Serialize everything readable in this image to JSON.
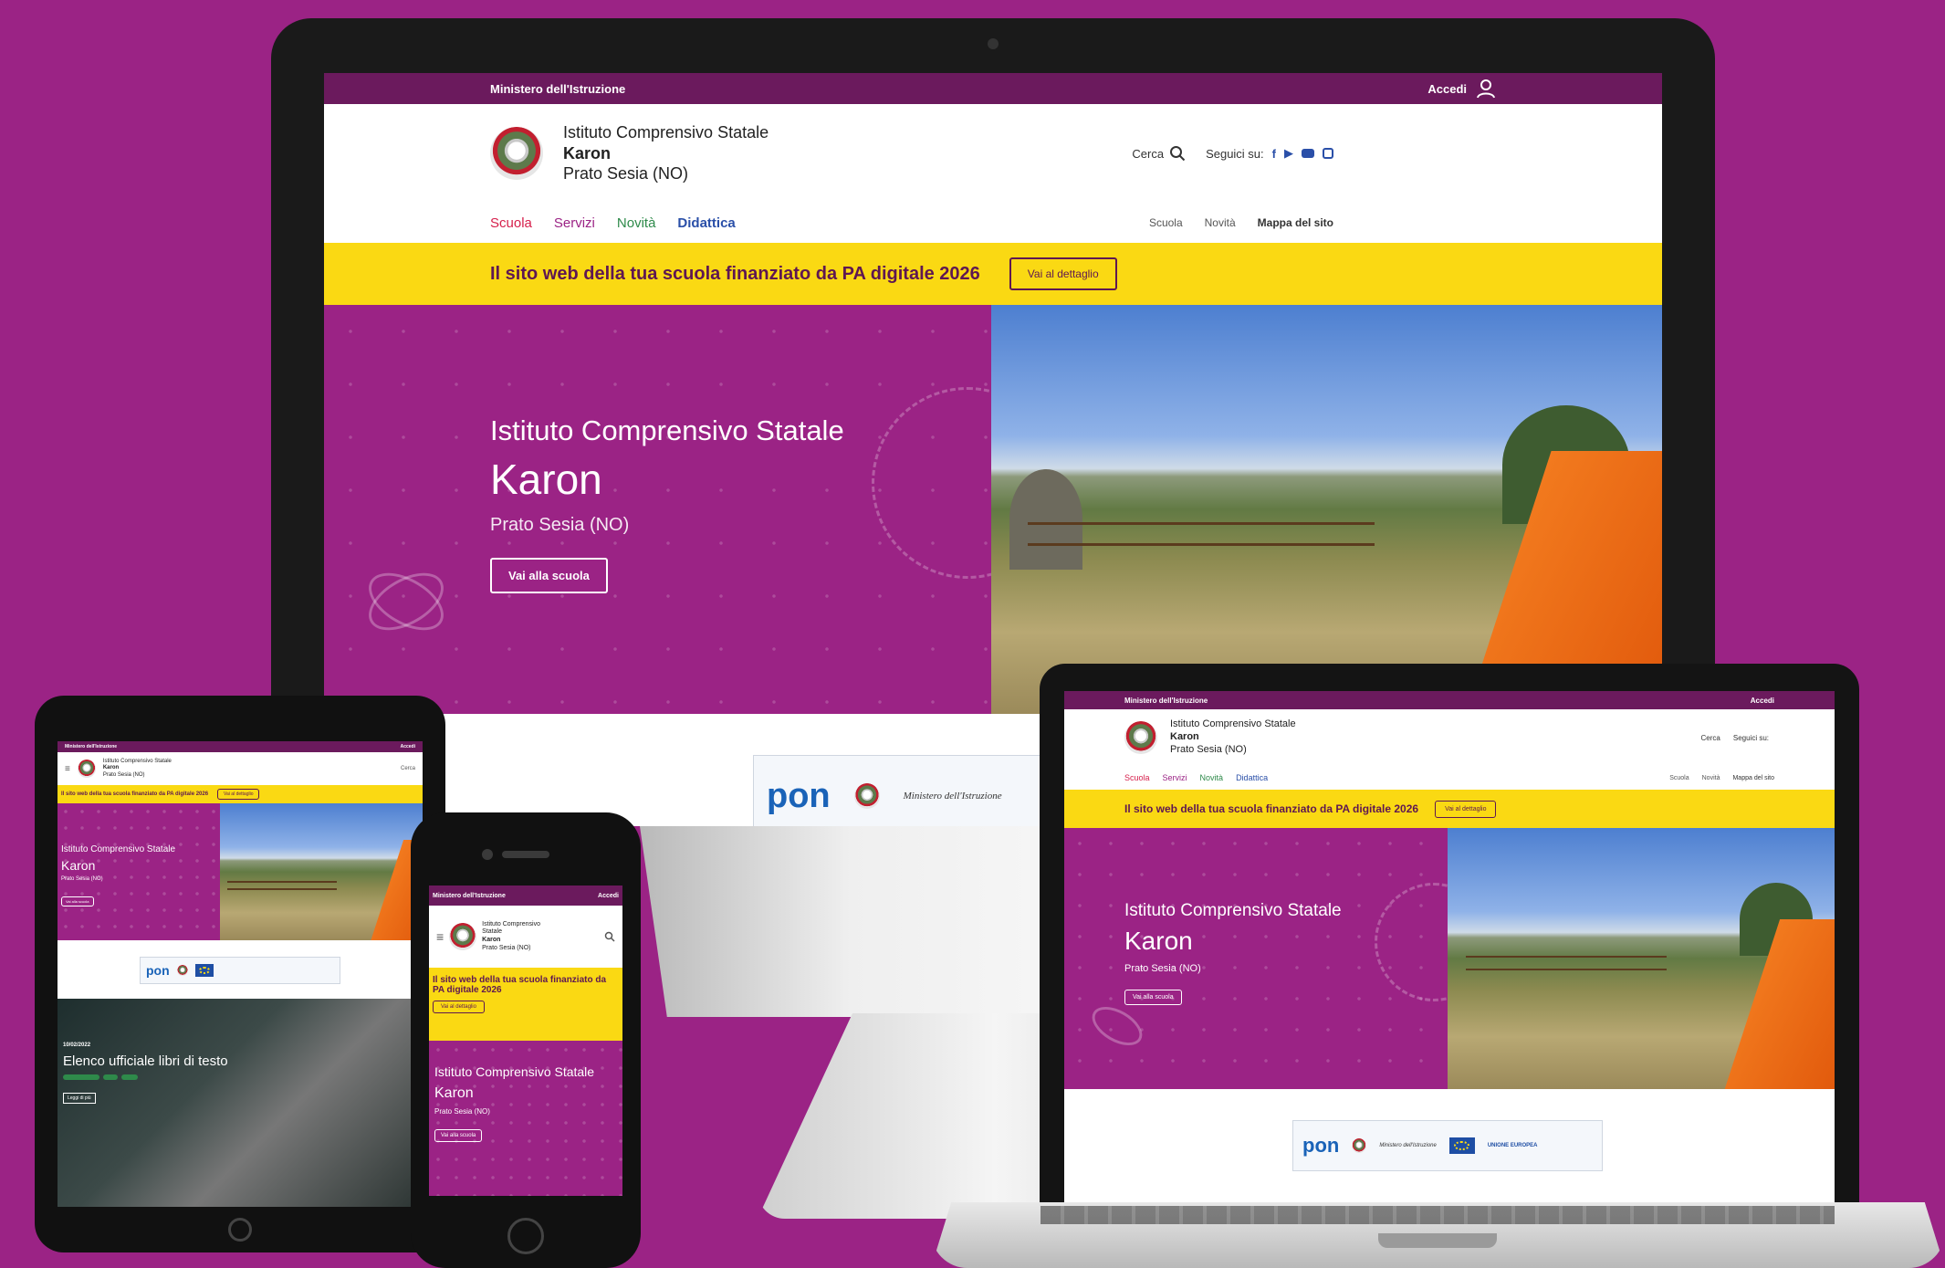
{
  "site": {
    "ministry": "Ministero dell'Istruzione",
    "login": "Accedi",
    "school_type": "Istituto Comprensivo Statale",
    "school_name": "Karon",
    "school_location": "Prato Sesia (NO)",
    "search_label": "Cerca",
    "follow_label": "Seguici su:",
    "nav_main": [
      "Scuola",
      "Servizi",
      "Novità",
      "Didattica"
    ],
    "nav_secondary": [
      "Scuola",
      "Novità",
      "Mappa del sito"
    ],
    "banner_text": "Il sito web della tua scuola finanziato da PA digitale 2026",
    "banner_button": "Vai al dettaglio",
    "hero_button": "Vai alla scuola",
    "pon_logo": "pon",
    "ministry_signature": "Ministero dell'Istruzione",
    "eu_label": "UNIONE EUROPEA"
  },
  "tablet": {
    "news_date": "10/02/2022",
    "news_title": "Elenco ufficiale libri di testo",
    "news_button": "Leggi di più"
  },
  "colors": {
    "brand_purple": "#9b2385",
    "top_bar": "#6b1a5d",
    "banner_yellow": "#fad913",
    "nav_scuola": "#d61f4b",
    "nav_servizi": "#9b2385",
    "nav_novita": "#2e8a4a",
    "nav_didattica": "#2a4fa8"
  }
}
